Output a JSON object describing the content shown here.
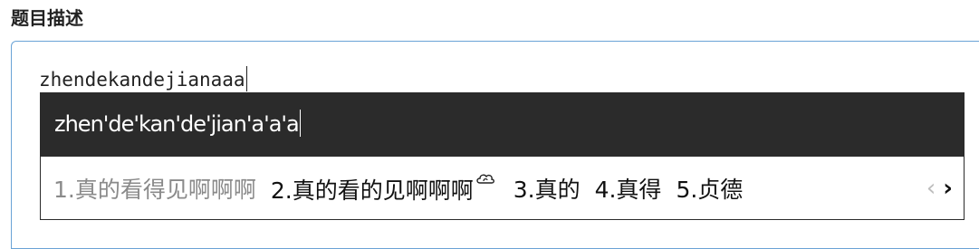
{
  "section": {
    "title": "题目描述"
  },
  "editor": {
    "text": "zhendekandejianaaa"
  },
  "ime": {
    "composition": "zhen'de'kan'de'jian'a'a'a",
    "candidates": [
      "1.真的看得见啊啊啊",
      "2.真的看的见啊啊啊",
      "3.真的",
      "4.真得",
      "5.贞德"
    ],
    "cloud_icon": "cloud-icon",
    "prev_icon": "chevron-left-icon",
    "next_icon": "chevron-right-icon",
    "prev_glyph": "‹",
    "next_glyph": "›"
  },
  "colors": {
    "composition_bg": "#2b2b2b",
    "editor_border": "#6aa3d6",
    "selected_candidate": "#8a8a8a"
  }
}
